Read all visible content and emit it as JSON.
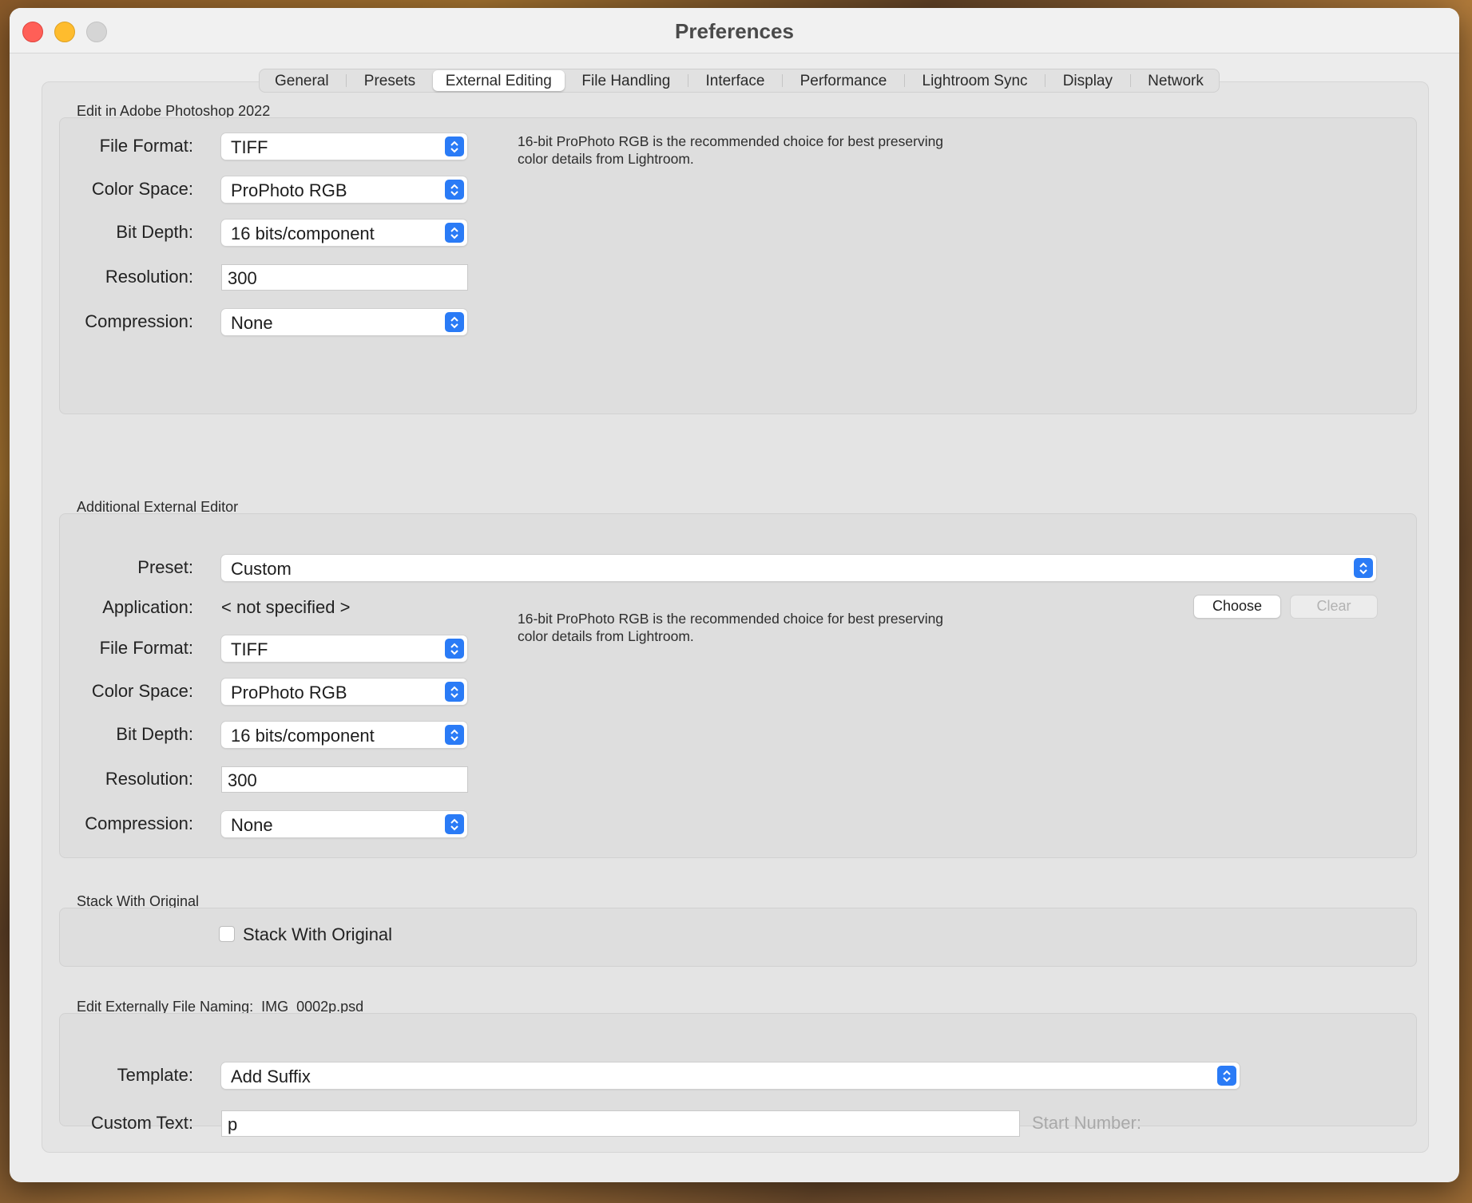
{
  "window": {
    "title": "Preferences"
  },
  "tabs": [
    {
      "label": "General",
      "active": false
    },
    {
      "label": "Presets",
      "active": false
    },
    {
      "label": "External Editing",
      "active": true
    },
    {
      "label": "File Handling",
      "active": false
    },
    {
      "label": "Interface",
      "active": false
    },
    {
      "label": "Performance",
      "active": false
    },
    {
      "label": "Lightroom Sync",
      "active": false
    },
    {
      "label": "Display",
      "active": false
    },
    {
      "label": "Network",
      "active": false
    }
  ],
  "photoshop": {
    "section_label": "Edit in Adobe Photoshop 2022",
    "file_format_label": "File Format:",
    "file_format_value": "TIFF",
    "color_space_label": "Color Space:",
    "color_space_value": "ProPhoto RGB",
    "bit_depth_label": "Bit Depth:",
    "bit_depth_value": "16 bits/component",
    "resolution_label": "Resolution:",
    "resolution_value": "300",
    "compression_label": "Compression:",
    "compression_value": "None",
    "note_line1": "16-bit ProPhoto RGB is the recommended choice for best preserving",
    "note_line2": "color details from Lightroom."
  },
  "additional": {
    "section_label": "Additional External Editor",
    "preset_label": "Preset:",
    "preset_value": "Custom",
    "application_label": "Application:",
    "application_value": "< not specified >",
    "choose_button": "Choose",
    "clear_button": "Clear",
    "file_format_label": "File Format:",
    "file_format_value": "TIFF",
    "color_space_label": "Color Space:",
    "color_space_value": "ProPhoto RGB",
    "bit_depth_label": "Bit Depth:",
    "bit_depth_value": "16 bits/component",
    "resolution_label": "Resolution:",
    "resolution_value": "300",
    "compression_label": "Compression:",
    "compression_value": "None",
    "note_line1": "16-bit ProPhoto RGB is the recommended choice for best preserving",
    "note_line2": "color details from Lightroom."
  },
  "stack": {
    "section_label": "Stack With Original",
    "checkbox_label": "Stack With Original",
    "checked": false
  },
  "naming": {
    "section_label": "Edit Externally File Naming:",
    "example": "IMG_0002p.psd",
    "template_label": "Template:",
    "template_value": "Add Suffix",
    "custom_text_label": "Custom Text:",
    "custom_text_value": "p",
    "start_number_label": "Start Number:"
  },
  "colors": {
    "accent": "#2a7bf6",
    "close": "#ff5f57",
    "minimize": "#febc2e",
    "maximize": "#d5d5d5"
  }
}
